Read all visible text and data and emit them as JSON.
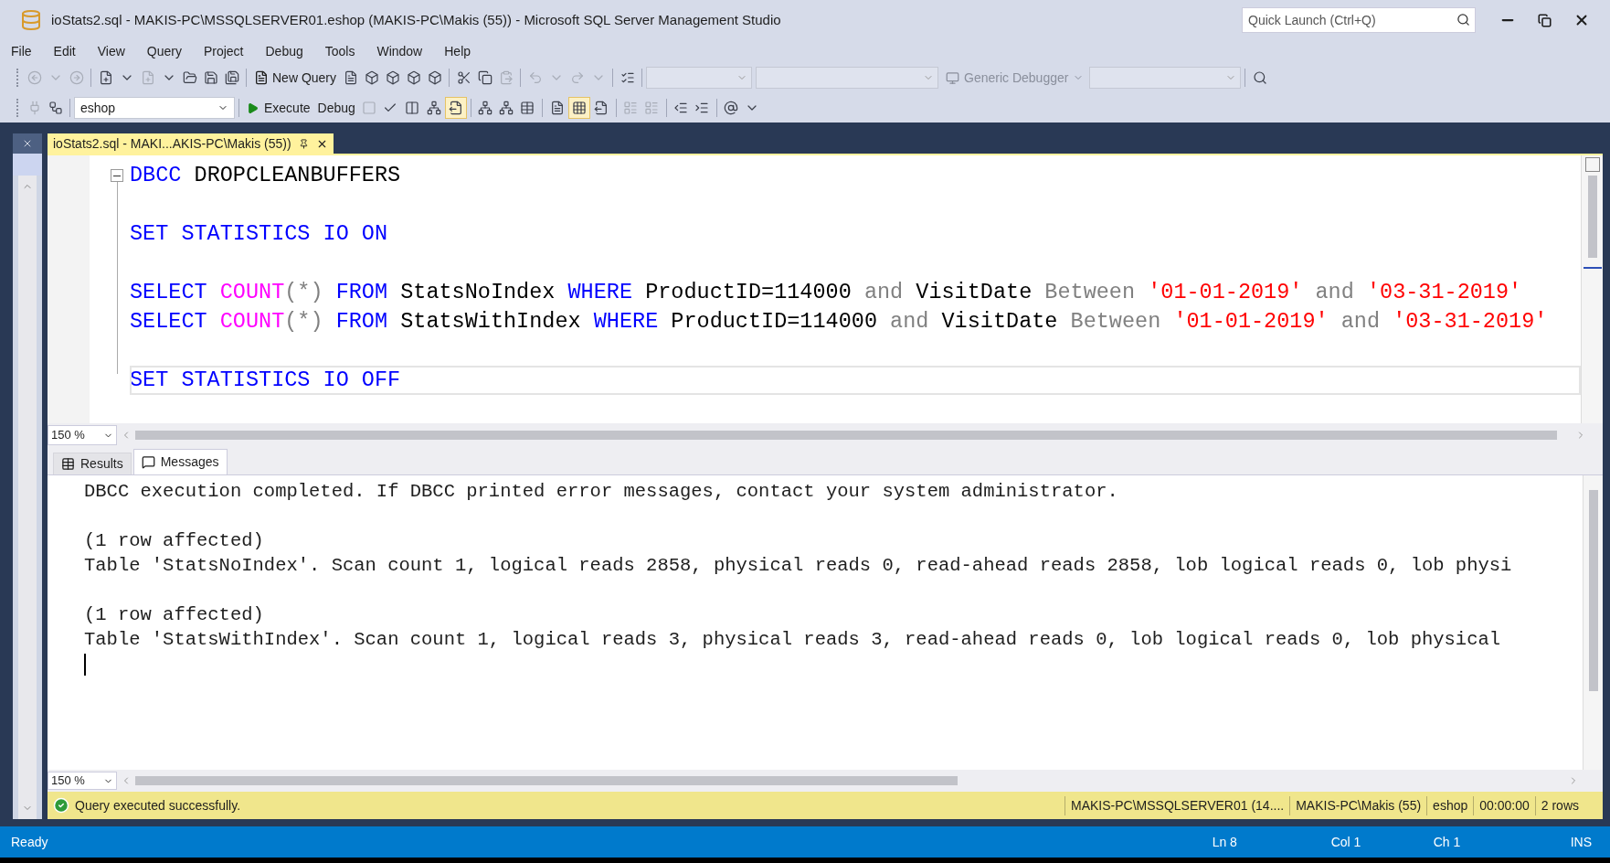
{
  "window": {
    "title": "ioStats2.sql - MAKIS-PC\\MSSQLSERVER01.eshop (MAKIS-PC\\Makis (55)) - Microsoft SQL Server Management Studio",
    "quick_launch": {
      "placeholder": "Quick Launch (Ctrl+Q)"
    }
  },
  "menu": [
    "File",
    "Edit",
    "View",
    "Query",
    "Project",
    "Debug",
    "Tools",
    "Window",
    "Help"
  ],
  "toolbar1": {
    "new_query": "New Query",
    "debugger": "Generic Debugger"
  },
  "toolbar2": {
    "database": "eshop",
    "execute": "Execute",
    "debug": "Debug",
    "result_modes": [
      {
        "selected": false
      },
      {
        "selected": false
      },
      {
        "selected": true
      }
    ],
    "plan_toggles": [
      {
        "selected": false
      },
      {
        "selected": true
      },
      {
        "selected": false
      }
    ]
  },
  "document_tabs": [
    {
      "label": "ioStats2.sql - MAKI...AKIS-PC\\Makis (55))",
      "selected": true
    }
  ],
  "editor": {
    "zoom": "150 %",
    "lines": [
      {
        "blank_before": false,
        "current": false,
        "tokens": [
          {
            "text": "DBCC",
            "kind": "keyword"
          },
          {
            "text": " DROPCLEANBUFFERS",
            "kind": "plain"
          }
        ]
      },
      {
        "blank_before": true,
        "current": false,
        "tokens": [
          {
            "text": "SET STATISTICS IO ON",
            "kind": "keyword"
          }
        ]
      },
      {
        "blank_before": true,
        "current": false,
        "tokens": [
          {
            "text": "SELECT ",
            "kind": "keyword"
          },
          {
            "text": "COUNT",
            "kind": "function"
          },
          {
            "text": "(*) ",
            "kind": "operator"
          },
          {
            "text": "FROM ",
            "kind": "keyword"
          },
          {
            "text": "StatsNoIndex ",
            "kind": "plain"
          },
          {
            "text": "WHERE ",
            "kind": "keyword"
          },
          {
            "text": "ProductID=114000 ",
            "kind": "plain"
          },
          {
            "text": "and ",
            "kind": "operator"
          },
          {
            "text": "VisitDate ",
            "kind": "plain"
          },
          {
            "text": "Between ",
            "kind": "operator"
          },
          {
            "text": "'01-01-2019'",
            "kind": "string"
          },
          {
            "text": " and ",
            "kind": "operator"
          },
          {
            "text": "'03-31-2019'",
            "kind": "string"
          }
        ]
      },
      {
        "blank_before": false,
        "current": false,
        "tokens": [
          {
            "text": "SELECT ",
            "kind": "keyword"
          },
          {
            "text": "COUNT",
            "kind": "function"
          },
          {
            "text": "(*) ",
            "kind": "operator"
          },
          {
            "text": "FROM ",
            "kind": "keyword"
          },
          {
            "text": "StatsWithIndex ",
            "kind": "plain"
          },
          {
            "text": "WHERE ",
            "kind": "keyword"
          },
          {
            "text": "ProductID=114000 ",
            "kind": "plain"
          },
          {
            "text": "and ",
            "kind": "operator"
          },
          {
            "text": "VisitDate ",
            "kind": "plain"
          },
          {
            "text": "Between ",
            "kind": "operator"
          },
          {
            "text": "'01-01-2019'",
            "kind": "string"
          },
          {
            "text": " and ",
            "kind": "operator"
          },
          {
            "text": "'03-31-2019'",
            "kind": "string"
          }
        ]
      },
      {
        "blank_before": true,
        "current": true,
        "tokens": [
          {
            "text": "SET STATISTICS IO OFF",
            "kind": "keyword"
          }
        ]
      }
    ]
  },
  "results_tabs": [
    {
      "label": "Results",
      "kind": "grid",
      "selected": false
    },
    {
      "label": "Messages",
      "kind": "messages",
      "selected": true
    }
  ],
  "messages": {
    "zoom": "150 %",
    "cursor": true,
    "lines": [
      {
        "blank_before": false,
        "text": "DBCC execution completed. If DBCC printed error messages, contact your system administrator."
      },
      {
        "blank_before": true,
        "text": "(1 row affected)"
      },
      {
        "blank_before": false,
        "text": "Table 'StatsNoIndex'. Scan count 1, logical reads 2858, physical reads 0, read-ahead reads 2858, lob logical reads 0, lob physi"
      },
      {
        "blank_before": true,
        "text": "(1 row affected)"
      },
      {
        "blank_before": false,
        "text": "Table 'StatsWithIndex'. Scan count 1, logical reads 3, physical reads 3, read-ahead reads 0, lob logical reads 0, lob physical"
      }
    ]
  },
  "query_status": {
    "success": true,
    "text": "Query executed successfully.",
    "segments": [
      "MAKIS-PC\\MSSQLSERVER01 (14....",
      "MAKIS-PC\\Makis (55)",
      "eshop",
      "00:00:00",
      "2 rows"
    ]
  },
  "status_bar": {
    "ready": "Ready",
    "line": "Ln 8",
    "column": "Col 1",
    "char": "Ch 1",
    "mode": "INS"
  }
}
